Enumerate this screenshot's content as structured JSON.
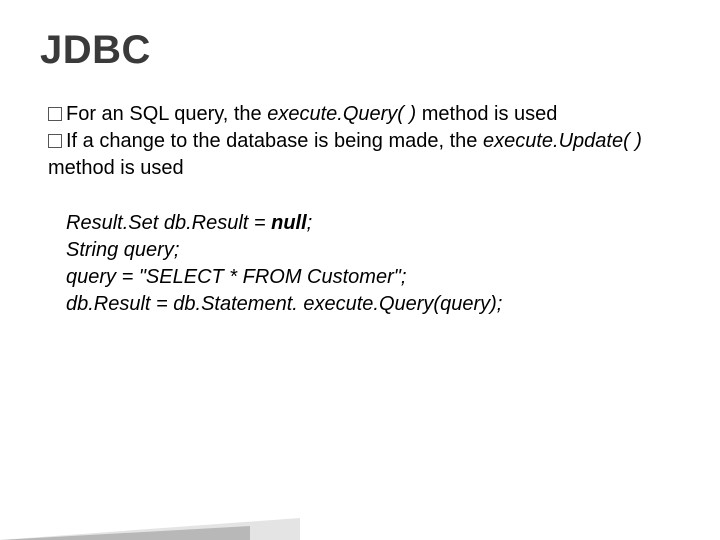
{
  "title": "JDBC",
  "bullet1": {
    "a": "For an SQL query, the ",
    "method": "execute.Query( )",
    "b": " method is used"
  },
  "bullet2": {
    "a": "If a change to the database is being made, the ",
    "method": "execute.Update( )",
    "b": " method is used"
  },
  "code": {
    "l1a": "Result.Set db.Result = ",
    "l1b": "null",
    "l1c": ";",
    "l2": "String query;",
    "l3": "query = \"SELECT * FROM Customer\";",
    "l4": "db.Result = db.Statement. execute.Query(query);"
  }
}
